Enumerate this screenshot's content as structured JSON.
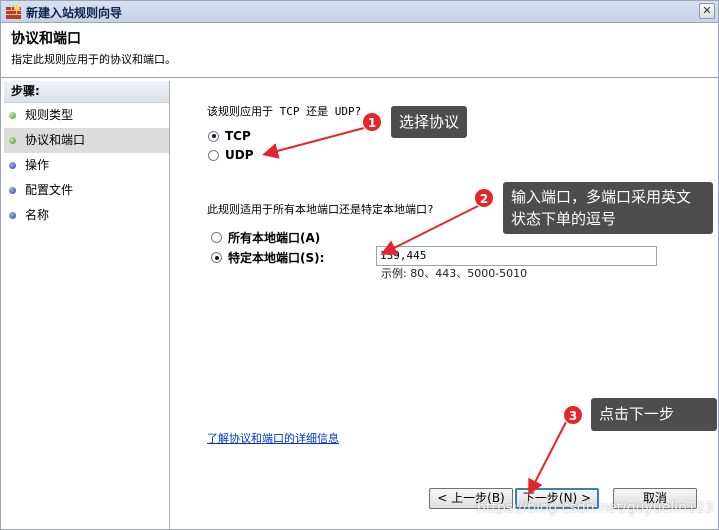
{
  "window": {
    "title": "新建入站规则向导",
    "close_glyph": "✕"
  },
  "header": {
    "title": "协议和端口",
    "subtitle": "指定此规则应用于的协议和端口。"
  },
  "steps": {
    "heading": "步骤:",
    "items": [
      {
        "label": "规则类型",
        "status": "green"
      },
      {
        "label": "协议和端口",
        "status": "green",
        "active": true
      },
      {
        "label": "操作",
        "status": "blue"
      },
      {
        "label": "配置文件",
        "status": "blue"
      },
      {
        "label": "名称",
        "status": "blue"
      }
    ]
  },
  "protocol": {
    "question": "该规则应用于 TCP 还是 UDP?",
    "options": [
      {
        "label": "TCP",
        "selected": true
      },
      {
        "label": "UDP",
        "selected": false
      }
    ]
  },
  "ports": {
    "question": "此规则适用于所有本地端口还是特定本地端口?",
    "options": [
      {
        "label": "所有本地端口(A)",
        "selected": false
      },
      {
        "label": "特定本地端口(S):",
        "selected": true
      }
    ],
    "value": "139,445",
    "example": "示例: 80、443、5000-5010"
  },
  "link": "了解协议和端口的详细信息",
  "buttons": {
    "back": "< 上一步(B)",
    "next": "下一步(N) >",
    "cancel": "取消"
  },
  "annotations": [
    {
      "number": "1",
      "text": "选择协议"
    },
    {
      "number": "2",
      "text": "输入端口，多端口采用英文状态下单的逗号"
    },
    {
      "number": "3",
      "text": "点击下一步"
    }
  ],
  "annotation_color": "#e3262a",
  "watermark": "https://blog.csdn.net/guyuelin123",
  "icons": [
    "app-icon",
    "close-icon",
    "step-dot-icon",
    "radio-icon",
    "arrow-icon"
  ]
}
